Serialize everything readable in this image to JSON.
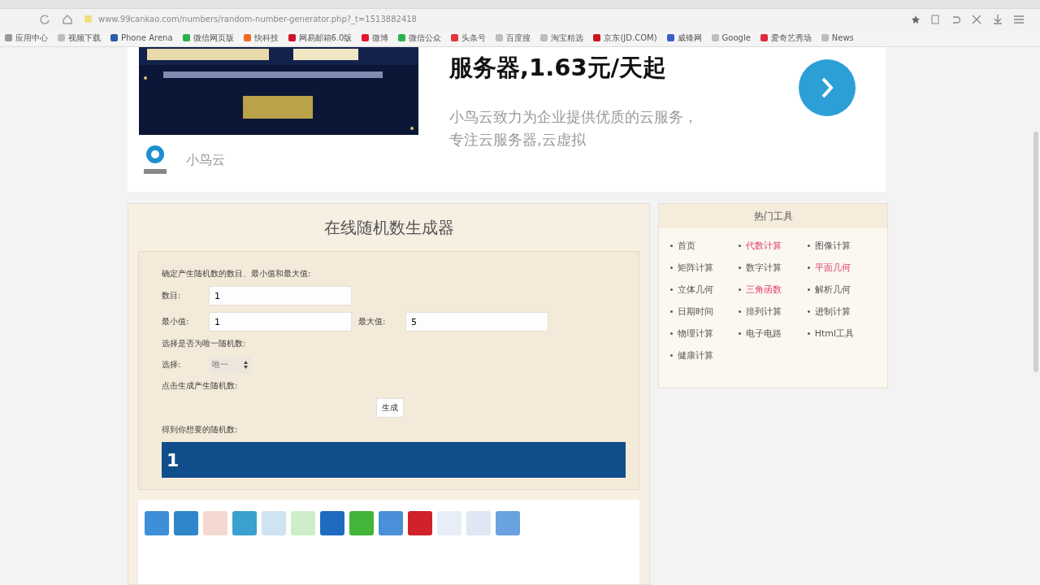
{
  "browser": {
    "url": "www.99cankao.com/numbers/random-number-generator.php?_t=1513882418",
    "bookmarks": [
      {
        "label": "应用中心",
        "color": "#9a9a9a"
      },
      {
        "label": "视频下载",
        "color": "#bdbdbd"
      },
      {
        "label": "Phone Arena",
        "color": "#2a5caa"
      },
      {
        "label": "微信网页版",
        "color": "#2bb24c"
      },
      {
        "label": "快科技",
        "color": "#f06a1e"
      },
      {
        "label": "网易邮箱6.0版",
        "color": "#d0112b"
      },
      {
        "label": "微博",
        "color": "#e6162d"
      },
      {
        "label": "微信公众",
        "color": "#2bb24c"
      },
      {
        "label": "头条号",
        "color": "#e0383e"
      },
      {
        "label": "百度搜",
        "color": "#bdbdbd"
      },
      {
        "label": "淘宝精选",
        "color": "#bdbdbd"
      },
      {
        "label": "京东(JD.COM)",
        "color": "#c91623"
      },
      {
        "label": "威锋网",
        "color": "#3a5fc8"
      },
      {
        "label": "Google",
        "color": "#bdbdbd"
      },
      {
        "label": "爱奇艺秀场",
        "color": "#e0283e"
      },
      {
        "label": "News",
        "color": "#bdbdbd"
      }
    ]
  },
  "ad": {
    "headline": "服务器,1.63元/天起",
    "description": "小鸟云致力为企业提供优质的云服务，专注云服务器,云虚拟",
    "brand": "小鸟云"
  },
  "generator": {
    "title": "在线随机数生成器",
    "intro": "确定产生随机数的数目、最小值和最大值:",
    "count_label": "数目:",
    "count_value": "1",
    "min_label": "最小值:",
    "min_value": "1",
    "max_label": "最大值:",
    "max_value": "5",
    "unique_prompt": "选择是否为唯一随机数:",
    "select_label": "选择:",
    "select_value": "唯一",
    "generate_prompt": "点击生成产生随机数:",
    "generate_button": "生成",
    "result_label": "得到你想要的随机数:",
    "result": "1"
  },
  "share_icons": [
    {
      "color": "#3d8fd8"
    },
    {
      "color": "#2f86c9"
    },
    {
      "color": "#f3d9cf"
    },
    {
      "color": "#3aa0d0"
    },
    {
      "color": "#cfe3f0"
    },
    {
      "color": "#cdeec8"
    },
    {
      "color": "#1e6bc0"
    },
    {
      "color": "#43b53a"
    },
    {
      "color": "#4a90d9"
    },
    {
      "color": "#d1212b"
    },
    {
      "color": "#e8eef8"
    },
    {
      "color": "#dfe7f2"
    },
    {
      "color": "#6aa2e0"
    }
  ],
  "hot_tools": {
    "title": "热门工具",
    "items": [
      {
        "label": "首页",
        "highlighted": false
      },
      {
        "label": "代数计算",
        "highlighted": true
      },
      {
        "label": "图像计算",
        "highlighted": false
      },
      {
        "label": "矩阵计算",
        "highlighted": false
      },
      {
        "label": "数字计算",
        "highlighted": false
      },
      {
        "label": "平面几何",
        "highlighted": true
      },
      {
        "label": "立体几何",
        "highlighted": false
      },
      {
        "label": "三角函数",
        "highlighted": true
      },
      {
        "label": "解析几何",
        "highlighted": false
      },
      {
        "label": "日期时间",
        "highlighted": false
      },
      {
        "label": "排列计算",
        "highlighted": false
      },
      {
        "label": "进制计算",
        "highlighted": false
      },
      {
        "label": "物理计算",
        "highlighted": false
      },
      {
        "label": "电子电路",
        "highlighted": false
      },
      {
        "label": "Html工具",
        "highlighted": false
      },
      {
        "label": "健康计算",
        "highlighted": false
      }
    ]
  }
}
